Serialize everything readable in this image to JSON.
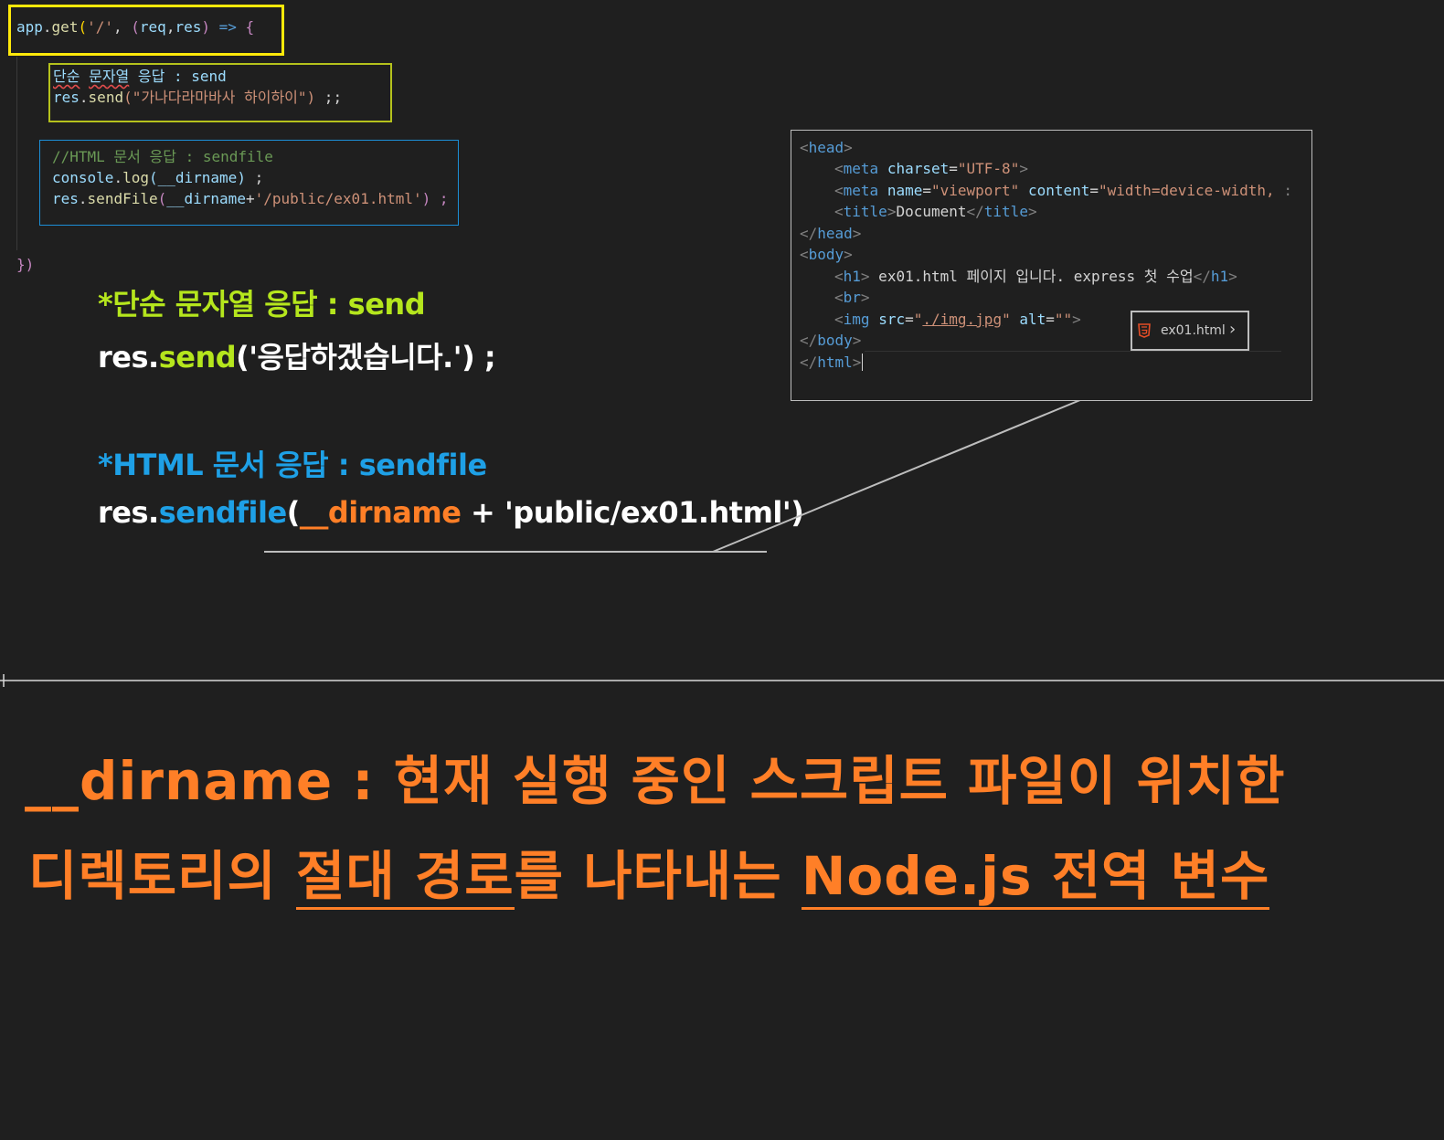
{
  "editor": {
    "line1": {
      "app": "app",
      "get": "get",
      "open": "('/'",
      "sep": ", ",
      "params_open": "(",
      "req": "req",
      "comma": ",",
      "res": "res",
      "params_close": ")",
      "arrow": " => ",
      "brace": "{"
    },
    "block1": {
      "comment": "단순 문자열 응답 : send",
      "code_res": "res",
      "code_send": "send",
      "code_arg": "(\"가나다라마바사 하이하이\")",
      "code_end": " ;;"
    },
    "block2": {
      "comment": "//HTML 문서 응답 : sendfile",
      "line2_obj": "console",
      "line2_fn": "log",
      "line2_arg": "(__dirname)",
      "line2_end": " ;",
      "line3_obj": "res",
      "line3_fn": "sendFile",
      "line3_open": "(",
      "line3_var": "__dirname",
      "line3_plus": "+",
      "line3_str": "'/public/ex01.html'",
      "line3_end": ") ;"
    },
    "closing": "})"
  },
  "notes": {
    "send_title": "*단순 문자열 응답 : send",
    "send_code_res": "res.",
    "send_code_fn": "send",
    "send_code_arg": "('응답하겠습니다.') ;",
    "sendfile_title": "*HTML 문서 응답 : sendfile",
    "sendfile_code_res": "res.",
    "sendfile_code_fn": "sendfile",
    "sendfile_code_paren": "(",
    "sendfile_code_var": "__dirname",
    "sendfile_code_rest": " + 'public/ex01.html')"
  },
  "html_preview": {
    "lines": [
      "<head>",
      "<meta charset=\"UTF-8\">",
      "<meta name=\"viewport\" content=\"width=device-width, :",
      "<title>Document</title>",
      "</head>",
      "<body>",
      "<h1> ex01.html 페이지 입니다. express 첫 수업</h1>",
      "<br>",
      "<img src=\"./img.jpg\" alt=\"\">",
      "</body>",
      "</html>"
    ],
    "tab_label": "ex01.html",
    "tab_chevron": "›"
  },
  "explanation": {
    "line1_term": "__dirname",
    "line1_rest": " : 현재 실행 중인 스크립트 파일이 위치한",
    "line2_a": "디렉토리의 ",
    "line2_b": "절대 경로",
    "line2_c": "를 나타내는 ",
    "line2_d": "Node.js 전역 변수"
  },
  "colors": {
    "background": "#1f1f1f",
    "highlight_yellow": "#ffe90a",
    "green_note": "#b5e61d",
    "blue_note": "#1ea0e6",
    "orange_text": "#ff7f27"
  }
}
